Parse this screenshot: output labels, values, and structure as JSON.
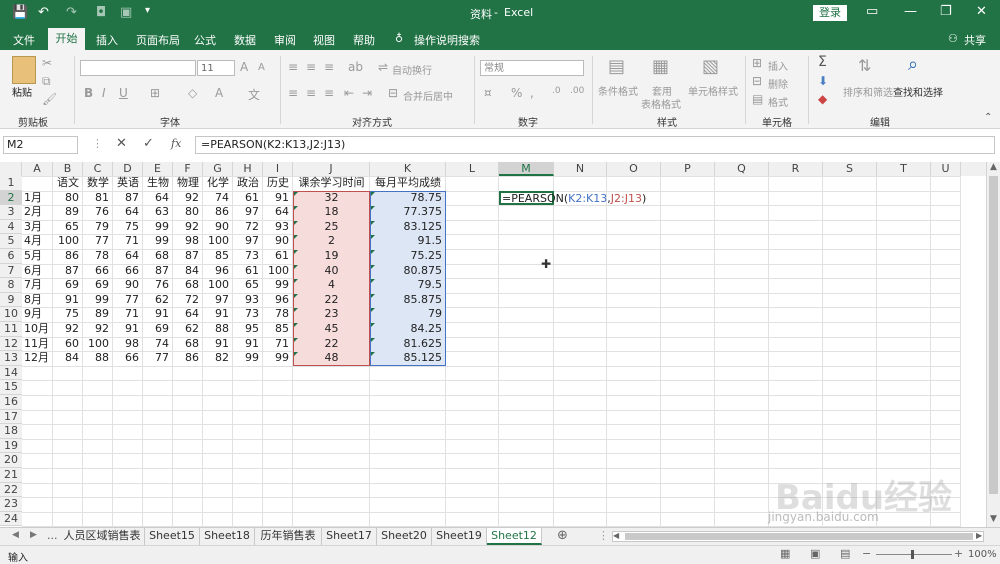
{
  "title_bar": {
    "doc_title": "资料",
    "app_name": "Excel",
    "login_label": "登录"
  },
  "menu": {
    "file": "文件",
    "home": "开始",
    "insert": "插入",
    "page_layout": "页面布局",
    "formulas": "公式",
    "data": "数据",
    "review": "审阅",
    "view": "视图",
    "help": "帮助",
    "tell_me": "操作说明搜索",
    "share": "共享"
  },
  "ribbon": {
    "groups": {
      "clipboard": "剪贴板",
      "font": "字体",
      "alignment": "对齐方式",
      "number": "数字",
      "styles": "样式",
      "cells": "单元格",
      "editing": "编辑"
    },
    "paste": "粘贴",
    "font_size": "11",
    "wrap_text": "自动换行",
    "merge_center": "合并后居中",
    "number_format": "常规",
    "cond_format": "条件格式",
    "table_format_1": "套用",
    "table_format_2": "表格格式",
    "cell_styles": "单元格样式",
    "insert_cells": "插入",
    "delete_cells": "删除",
    "format_cells": "格式",
    "sort_filter": "排序和筛选",
    "find_select": "查找和选择"
  },
  "formula_bar": {
    "name_box": "M2",
    "formula": "=PEARSON(K2:K13,J2:J13)",
    "fx": "fx"
  },
  "columns": [
    "A",
    "B",
    "C",
    "D",
    "E",
    "F",
    "G",
    "H",
    "I",
    "J",
    "K",
    "L",
    "M",
    "N",
    "O",
    "P",
    "Q",
    "R",
    "S",
    "T",
    "U"
  ],
  "rows": [
    "1",
    "2",
    "3",
    "4",
    "5",
    "6",
    "7",
    "8",
    "9",
    "10",
    "11",
    "12",
    "13",
    "14",
    "15",
    "16",
    "17",
    "18",
    "19",
    "20",
    "21",
    "22",
    "23",
    "24"
  ],
  "headers": [
    "语文",
    "数学",
    "英语",
    "生物",
    "物理",
    "化学",
    "政治",
    "历史",
    "课余学习时间",
    "每月平均成绩"
  ],
  "table": [
    [
      "1月",
      "80",
      "81",
      "87",
      "64",
      "92",
      "74",
      "61",
      "91",
      "32",
      "78.75"
    ],
    [
      "2月",
      "89",
      "76",
      "64",
      "63",
      "80",
      "86",
      "97",
      "64",
      "18",
      "77.375"
    ],
    [
      "3月",
      "65",
      "79",
      "75",
      "99",
      "92",
      "90",
      "72",
      "93",
      "25",
      "83.125"
    ],
    [
      "4月",
      "100",
      "77",
      "71",
      "99",
      "98",
      "100",
      "97",
      "90",
      "2",
      "91.5"
    ],
    [
      "5月",
      "86",
      "78",
      "64",
      "68",
      "87",
      "85",
      "73",
      "61",
      "19",
      "75.25"
    ],
    [
      "6月",
      "87",
      "66",
      "66",
      "87",
      "84",
      "96",
      "61",
      "100",
      "40",
      "80.875"
    ],
    [
      "7月",
      "69",
      "69",
      "90",
      "76",
      "68",
      "100",
      "65",
      "99",
      "4",
      "79.5"
    ],
    [
      "8月",
      "91",
      "99",
      "77",
      "62",
      "72",
      "97",
      "93",
      "96",
      "22",
      "85.875"
    ],
    [
      "9月",
      "75",
      "89",
      "71",
      "91",
      "64",
      "91",
      "73",
      "78",
      "23",
      "79"
    ],
    [
      "10月",
      "92",
      "92",
      "91",
      "69",
      "62",
      "88",
      "95",
      "85",
      "45",
      "84.25"
    ],
    [
      "11月",
      "60",
      "100",
      "98",
      "74",
      "68",
      "91",
      "91",
      "71",
      "22",
      "81.625"
    ],
    [
      "12月",
      "84",
      "88",
      "66",
      "77",
      "86",
      "82",
      "99",
      "99",
      "48",
      "85.125"
    ]
  ],
  "edit_cell": {
    "prefix": "=PEARSON(",
    "ref1": "K2:K13",
    "comma": ",",
    "ref2": "J2:J13",
    "suffix": ")"
  },
  "sheet_tabs": [
    "人员区域销售表",
    "Sheet15",
    "Sheet18",
    "历年销售表",
    "Sheet17",
    "Sheet20",
    "Sheet19",
    "Sheet12"
  ],
  "active_sheet": "Sheet12",
  "status": {
    "mode": "输入",
    "zoom": "100%"
  },
  "watermark": {
    "brand": "Baidu经验",
    "url": "jingyan.baidu.com"
  },
  "colors": {
    "excel_green": "#217346",
    "ref_blue": "#4472c4",
    "ref_red": "#c0504d",
    "blue_fill": "#dde6f5",
    "red_fill": "#f7dcdc"
  }
}
